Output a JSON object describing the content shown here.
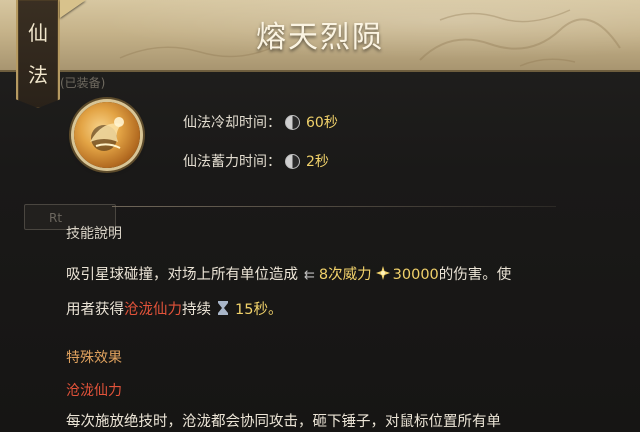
{
  "header": {
    "title": "熔天烈陨"
  },
  "side_tab": {
    "char_1": "仙",
    "char_2": "法"
  },
  "faint_tag": "(已装备)",
  "stats": {
    "cooldown_label": "仙法冷却时间：",
    "cooldown_value": "60秒",
    "charge_label": "仙法蓄力时间：",
    "charge_value": "2秒"
  },
  "ghost_button_label": "Rt",
  "description": {
    "heading": "技能說明",
    "line1_a": "吸引星球碰撞，对场上所有单位造成",
    "line1_hits": "8次威力",
    "line1_power": "30000",
    "line1_b": "的伤害。使",
    "line2_a": "用者获得",
    "line2_buff": "沧泷仙力",
    "line2_b": "持续",
    "line2_duration": "15秒。"
  },
  "special": {
    "heading": "特殊效果",
    "effect_name": "沧泷仙力",
    "effect_text": "每次施放绝技时，沧泷都会协同攻击，砸下锤子，对鼠标位置所有单"
  },
  "colors": {
    "gold": "#f0d16a",
    "red": "#e2533a",
    "orange": "#e0a25e"
  },
  "icons": [
    "clock-icon",
    "arrow-icon",
    "burst-icon",
    "hourglass-icon",
    "skill-icon"
  ]
}
